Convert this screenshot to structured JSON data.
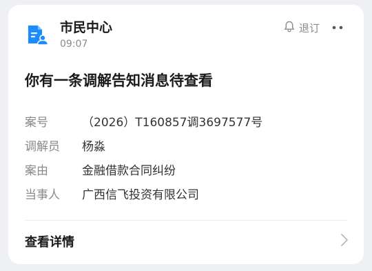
{
  "app": {
    "name": "市民中心",
    "time": "09:07",
    "subscribe_label": "退订"
  },
  "message": {
    "title": "你有一条调解告知消息待查看",
    "fields": [
      {
        "label": "案号",
        "value": "（2026）T160857调3697577号"
      },
      {
        "label": "调解员",
        "value": "杨淼"
      },
      {
        "label": "案由",
        "value": "金融借款合同纠纷"
      },
      {
        "label": "当事人",
        "value": "广西信飞投资有限公司"
      }
    ]
  },
  "footer": {
    "link_label": "查看详情"
  },
  "colors": {
    "brand": "#1a8cff",
    "card": "#ffffff",
    "background": "#eef0f3"
  },
  "icons": {
    "app": "document-user-icon",
    "subscribe": "bell-icon",
    "more": "more-dots-icon",
    "footer": "chevron-right-icon"
  }
}
